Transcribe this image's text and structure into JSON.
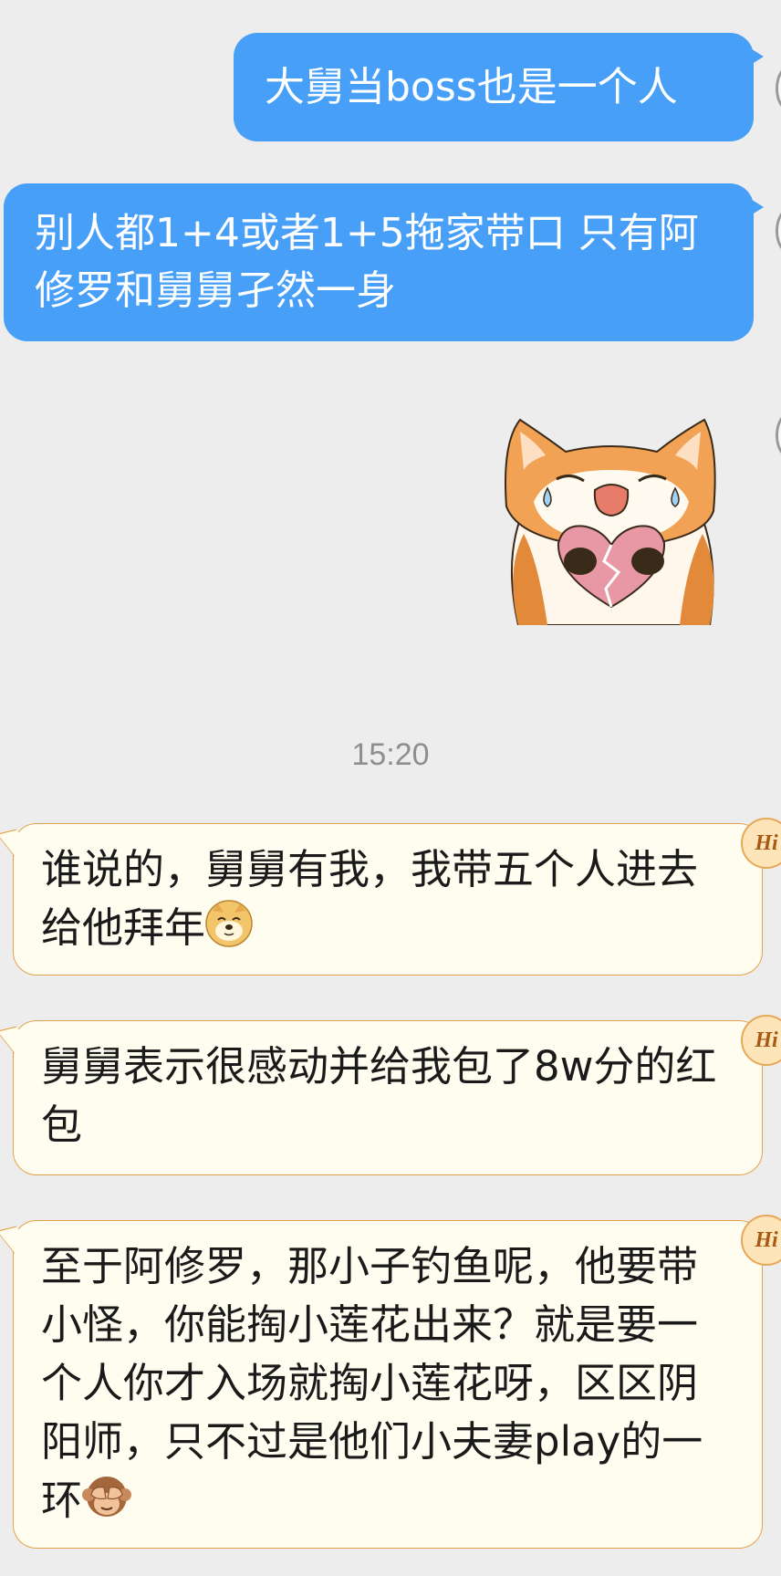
{
  "messages": [
    {
      "side": "out",
      "text": "大舅当boss也是一个人"
    },
    {
      "side": "out",
      "text": "别人都1+4或者1+5拖家带口 只有阿修罗和舅舅孑然一身"
    },
    {
      "side": "out",
      "type": "sticker",
      "icon": "crying-cat-broken-heart-sticker"
    },
    {
      "side": "in",
      "text": "谁说的，舅舅有我，我带五个人进去给他拜年",
      "emoji": "doge-emoji"
    },
    {
      "side": "in",
      "text": "舅舅表示很感动并给我包了8w分的红包"
    },
    {
      "side": "in",
      "text": "至于阿修罗，那小子钓鱼呢，他要带小怪，你能掏小莲花出来？就是要一个人你才入场就掏小莲花呀，区区阴阳师，只不过是他们小夫妻play的一环",
      "emoji": "see-no-evil-monkey-emoji"
    }
  ],
  "timestamp": "15:20",
  "badge": "Hi",
  "colors": {
    "outgoing": "#479ff8",
    "incoming": "#fffdf0",
    "incoming_border": "#e2a24a",
    "background": "#ededed"
  }
}
